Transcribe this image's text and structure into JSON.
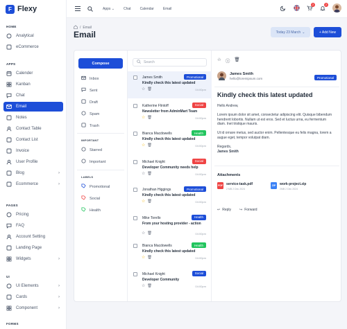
{
  "brand": {
    "name": "Flexy",
    "logo": "F"
  },
  "sidebar": {
    "sections": [
      {
        "title": "HOME",
        "items": [
          {
            "label": "Analytical",
            "icon": "analytics-icon"
          },
          {
            "label": "eCommerce",
            "icon": "shop-icon"
          }
        ]
      },
      {
        "title": "APPS",
        "items": [
          {
            "label": "Calender",
            "icon": "calendar-icon"
          },
          {
            "label": "Kanban",
            "icon": "kanban-icon"
          },
          {
            "label": "Chat",
            "icon": "chat-icon"
          },
          {
            "label": "Email",
            "icon": "mail-icon",
            "active": true
          },
          {
            "label": "Notes",
            "icon": "notes-icon"
          },
          {
            "label": "Contact Table",
            "icon": "contact-icon"
          },
          {
            "label": "Contact List",
            "icon": "list-icon"
          },
          {
            "label": "Invoice",
            "icon": "invoice-icon"
          },
          {
            "label": "User Profile",
            "icon": "user-icon"
          },
          {
            "label": "Blog",
            "icon": "blog-icon",
            "chevron": true
          },
          {
            "label": "Ecommerce",
            "icon": "cart-icon",
            "chevron": true
          }
        ]
      },
      {
        "title": "PAGES",
        "items": [
          {
            "label": "Pricing",
            "icon": "pricing-icon"
          },
          {
            "label": "FAQ",
            "icon": "faq-icon"
          },
          {
            "label": "Account Setting",
            "icon": "settings-icon"
          },
          {
            "label": "Landing Page",
            "icon": "landing-icon"
          },
          {
            "label": "Widgets",
            "icon": "widgets-icon",
            "chevron": true
          }
        ]
      },
      {
        "title": "UI",
        "items": [
          {
            "label": "UI Elements",
            "icon": "elements-icon",
            "chevron": true
          },
          {
            "label": "Cards",
            "icon": "cards-icon",
            "chevron": true
          },
          {
            "label": "Component",
            "icon": "component-icon",
            "chevron": true
          }
        ]
      },
      {
        "title": "FORMS",
        "items": []
      }
    ]
  },
  "topbar": {
    "links": [
      "Apps",
      "Chat",
      "Calendar",
      "Email"
    ],
    "notifications": {
      "cart": "2",
      "bell": "2"
    }
  },
  "header": {
    "breadcrumb": "Email",
    "title": "Email",
    "date": "Today 23 March",
    "add_new": "+ Add New"
  },
  "left": {
    "compose": "Compose",
    "folders": [
      {
        "label": "Inbox",
        "icon": "inbox-icon"
      },
      {
        "label": "Sent",
        "icon": "send-icon"
      },
      {
        "label": "Draft",
        "icon": "draft-icon"
      },
      {
        "label": "Spam",
        "icon": "spam-icon"
      },
      {
        "label": "Trash",
        "icon": "trash-icon"
      }
    ],
    "important_title": "IMPORTANT",
    "important": [
      {
        "label": "Starred",
        "icon": "star-icon"
      },
      {
        "label": "Important",
        "icon": "important-icon"
      }
    ],
    "labels_title": "LABELS",
    "labels": [
      {
        "label": "Promotional",
        "color": "#1d4ed8"
      },
      {
        "label": "Social",
        "color": "#ef4444"
      },
      {
        "label": "Health",
        "color": "#22c55e"
      }
    ]
  },
  "search": {
    "placeholder": "Search"
  },
  "mails": [
    {
      "name": "James Smith",
      "badge": "Promotional",
      "badge_color": "#1d4ed8",
      "subject": "Kindly check this latest updated",
      "time": "04:00pm",
      "starred": false,
      "selected": true
    },
    {
      "name": "Katherine Flintoff",
      "badge": "Social",
      "badge_color": "#ef4444",
      "subject": "Newsletter from AdminMart Team",
      "time": "04:00pm",
      "starred": true,
      "selected": false
    },
    {
      "name": "Bianca Macdowells",
      "badge": "Health",
      "badge_color": "#22c55e",
      "subject": "Kindly check this latest updated",
      "time": "04:00pm",
      "starred": true,
      "selected": false
    },
    {
      "name": "Michael Knight",
      "badge": "Social",
      "badge_color": "#ef4444",
      "subject": "Developer Community needs help",
      "time": "04:00pm",
      "starred": false,
      "selected": false
    },
    {
      "name": "Jonathan Higgings",
      "badge": "Promotional",
      "badge_color": "#1d4ed8",
      "subject": "Kindly check this latest updated",
      "time": "04:00pm",
      "starred": true,
      "selected": false
    },
    {
      "name": "Mike Torello",
      "badge": "Health",
      "badge_color": "#1d4ed8",
      "subject": "From your hosting provider - action",
      "time": "04:00pm",
      "starred": false,
      "selected": false
    },
    {
      "name": "Bianca Macdowells",
      "badge": "Health",
      "badge_color": "#22c55e",
      "subject": "Kindly check this latest updated",
      "time": "04:00pm",
      "starred": true,
      "selected": false
    },
    {
      "name": "Michael Knight",
      "badge": "Social",
      "badge_color": "#1d4ed8",
      "subject": "Developer Community",
      "time": "04:00pm",
      "starred": false,
      "selected": false
    }
  ],
  "detail": {
    "sender_name": "James Smith",
    "sender_email": "hello@loremipsum.com",
    "badge": "Promotional",
    "subject": "Kindly check this latest updated",
    "greeting": "Hello Andrew,",
    "para1": "Lorem ipsum dolor sit amet, consectetur adipiscing elit. Quisque bibendum hendrerit lobortis. Nullam ut est eros. Sed et luctus urna, eu fermentum diam. Inet tristique mauris.",
    "para2": "Ut id ornare metus, sed auctor enim. Pellentesque eu felis magna, lorem a augue eget, tempor volutpat diam.",
    "regards": "Regards,",
    "signature": "James Smith",
    "attachments_title": "Attachments",
    "attachments": [
      {
        "name": "service-task.pdf",
        "meta": "2 MB   2 Dec 2024",
        "type": "pdf",
        "color": "#ef4444"
      },
      {
        "name": "work-project.zip",
        "meta": "2MB   2 Dec 2024",
        "type": "zip",
        "color": "#3b82f6"
      }
    ],
    "reply": "Reply",
    "forward": "Forward"
  }
}
